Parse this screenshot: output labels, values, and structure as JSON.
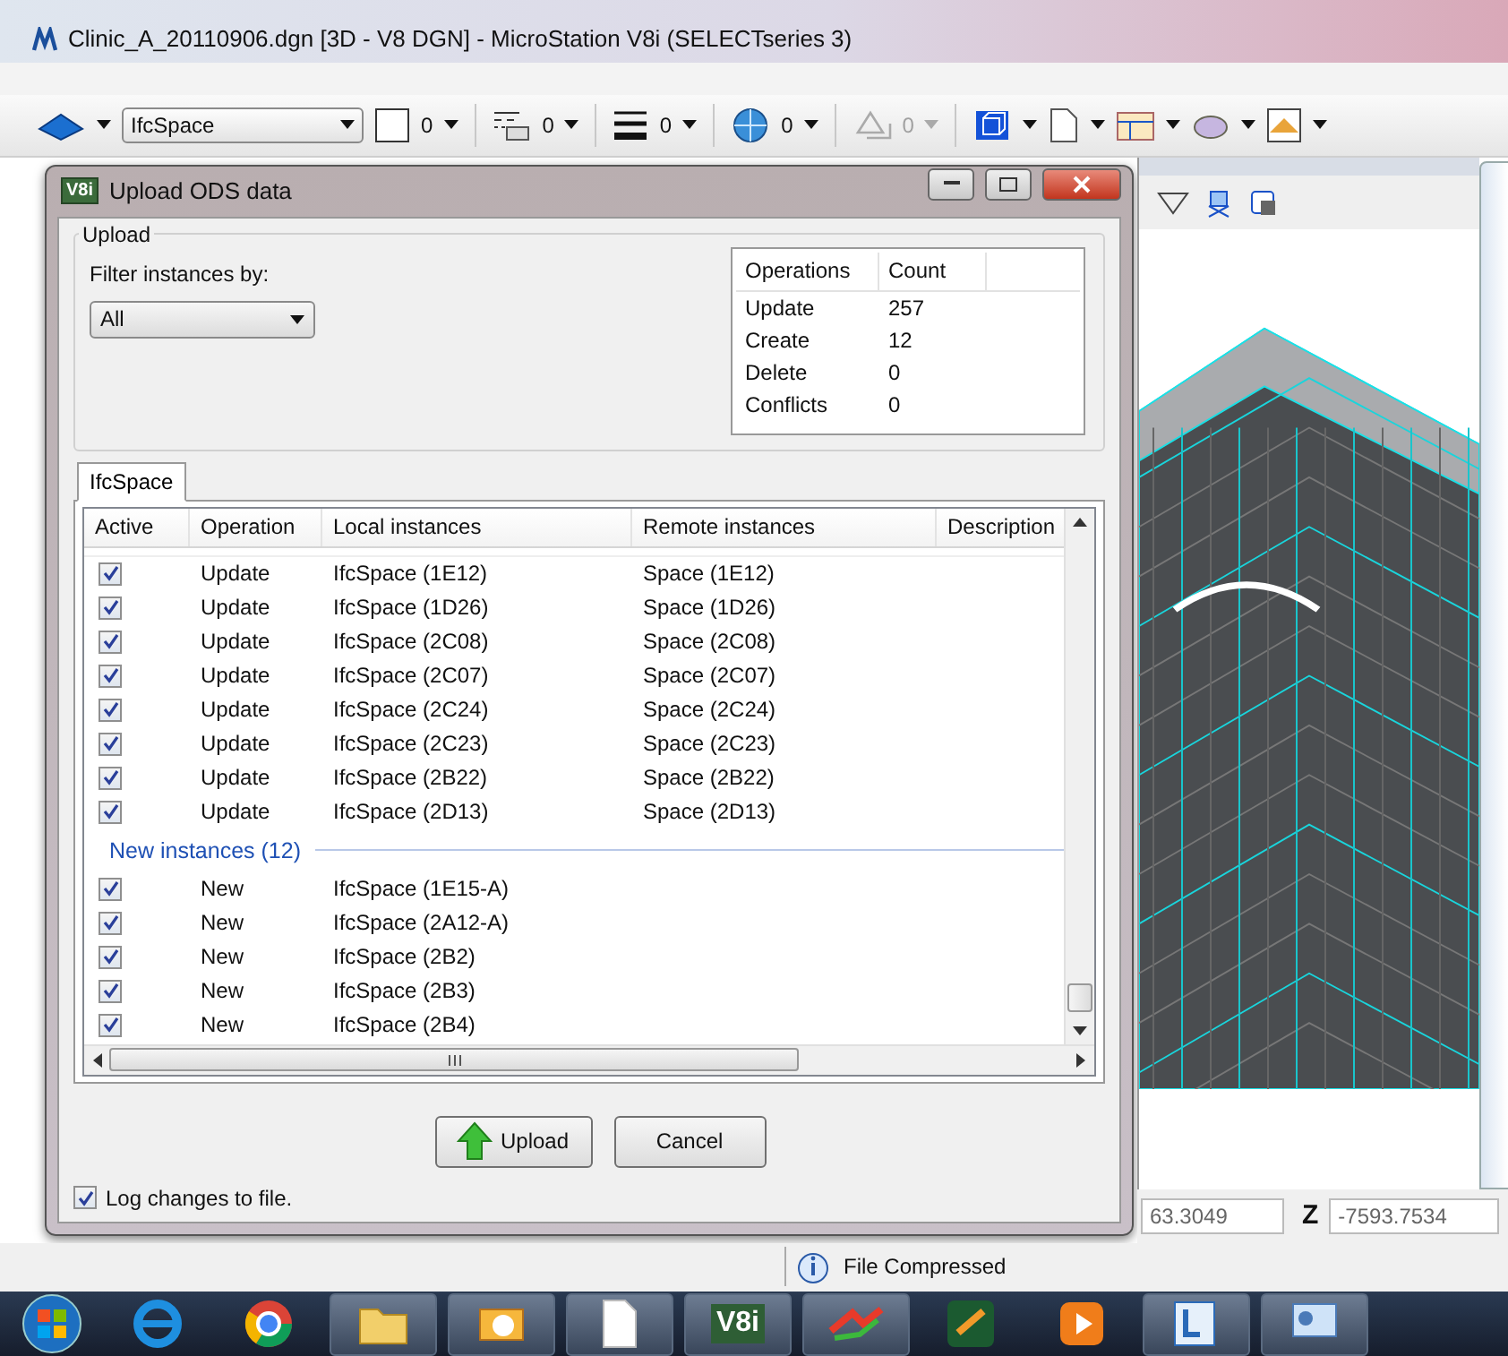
{
  "app_window": {
    "title": "Clinic_A_20110906.dgn [3D - V8 DGN] - MicroStation V8i (SELECTseries 3)"
  },
  "toolbar": {
    "level_combo": "IfcSpace",
    "attributes": [
      {
        "kind": "color",
        "value": "0",
        "disabled": false
      },
      {
        "kind": "style",
        "value": "0",
        "disabled": false
      },
      {
        "kind": "weight",
        "value": "0",
        "disabled": false
      },
      {
        "kind": "transparency",
        "value": "0",
        "disabled": false
      },
      {
        "kind": "priority",
        "value": "0",
        "disabled": true
      }
    ]
  },
  "dialog": {
    "title": "Upload ODS data",
    "icon_label": "V8i",
    "group_label": "Upload",
    "filter_label": "Filter instances by:",
    "filter_value": "All",
    "summary": {
      "columns": [
        "Operations",
        "Count"
      ],
      "rows": [
        {
          "operation": "Update",
          "count": "257"
        },
        {
          "operation": "Create",
          "count": "12"
        },
        {
          "operation": "Delete",
          "count": "0"
        },
        {
          "operation": "Conflicts",
          "count": "0"
        }
      ]
    },
    "tabs": [
      {
        "label": "IfcSpace",
        "selected": true
      }
    ],
    "grid": {
      "columns": [
        "Active",
        "Operation",
        "Local instances",
        "Remote instances",
        "Description"
      ],
      "rows": [
        {
          "kind": "row",
          "active": true,
          "operation": "Update",
          "local": "IfcSpace (1E12)",
          "remote": "Space (1E12)"
        },
        {
          "kind": "row",
          "active": true,
          "operation": "Update",
          "local": "IfcSpace (1D26)",
          "remote": "Space (1D26)"
        },
        {
          "kind": "row",
          "active": true,
          "operation": "Update",
          "local": "IfcSpace (2C08)",
          "remote": "Space (2C08)"
        },
        {
          "kind": "row",
          "active": true,
          "operation": "Update",
          "local": "IfcSpace (2C07)",
          "remote": "Space (2C07)"
        },
        {
          "kind": "row",
          "active": true,
          "operation": "Update",
          "local": "IfcSpace (2C24)",
          "remote": "Space (2C24)"
        },
        {
          "kind": "row",
          "active": true,
          "operation": "Update",
          "local": "IfcSpace (2C23)",
          "remote": "Space (2C23)"
        },
        {
          "kind": "row",
          "active": true,
          "operation": "Update",
          "local": "IfcSpace (2B22)",
          "remote": "Space (2B22)"
        },
        {
          "kind": "row",
          "active": true,
          "operation": "Update",
          "local": "IfcSpace (2D13)",
          "remote": "Space (2D13)"
        },
        {
          "kind": "group",
          "label": "New instances (12)"
        },
        {
          "kind": "row",
          "active": true,
          "operation": "New",
          "local": "IfcSpace (1E15-A)"
        },
        {
          "kind": "row",
          "active": true,
          "operation": "New",
          "local": "IfcSpace (2A12-A)"
        },
        {
          "kind": "row",
          "active": true,
          "operation": "New",
          "local": "IfcSpace (2B2)"
        },
        {
          "kind": "row",
          "active": true,
          "operation": "New",
          "local": "IfcSpace (2B3)"
        },
        {
          "kind": "row",
          "active": true,
          "operation": "New",
          "local": "IfcSpace (2B4)"
        }
      ]
    },
    "buttons": [
      {
        "kind": "upload",
        "label": "Upload"
      },
      {
        "kind": "cancel",
        "label": "Cancel"
      }
    ],
    "log_changes": {
      "label": "Log changes to file.",
      "checked": true
    }
  },
  "coordinates": [
    {
      "value": "63.3049"
    },
    {
      "label": "Z",
      "value": "-7593.7534"
    }
  ],
  "status_bar": {
    "message": "File Compressed"
  },
  "taskbar": {
    "v8i_label": "V8i"
  }
}
